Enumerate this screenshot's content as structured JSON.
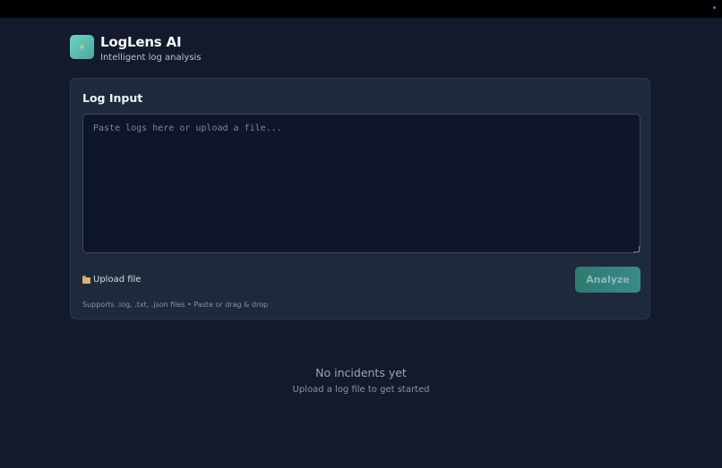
{
  "app": {
    "title": "LogLens AI",
    "subtitle": "Intelligent log analysis",
    "logo_icon": "lightning-bolt-icon",
    "logo_glyph": "⚡"
  },
  "input_panel": {
    "title": "Log Input",
    "textarea": {
      "value": "",
      "placeholder": "Paste logs here or upload a file..."
    },
    "upload": {
      "icon": "folder-icon",
      "label": "Upload file"
    },
    "analyze_label": "Analyze",
    "hint": "Supports .log, .txt, .json files • Paste or drag & drop"
  },
  "empty_state": {
    "title": "No incidents yet",
    "subtitle": "Upload a log file to get started"
  },
  "colors": {
    "background": "#131a2b",
    "panel": "#1e293b",
    "accent": "#3a8a8d",
    "logo_gradient_start": "#6fd3c0"
  }
}
